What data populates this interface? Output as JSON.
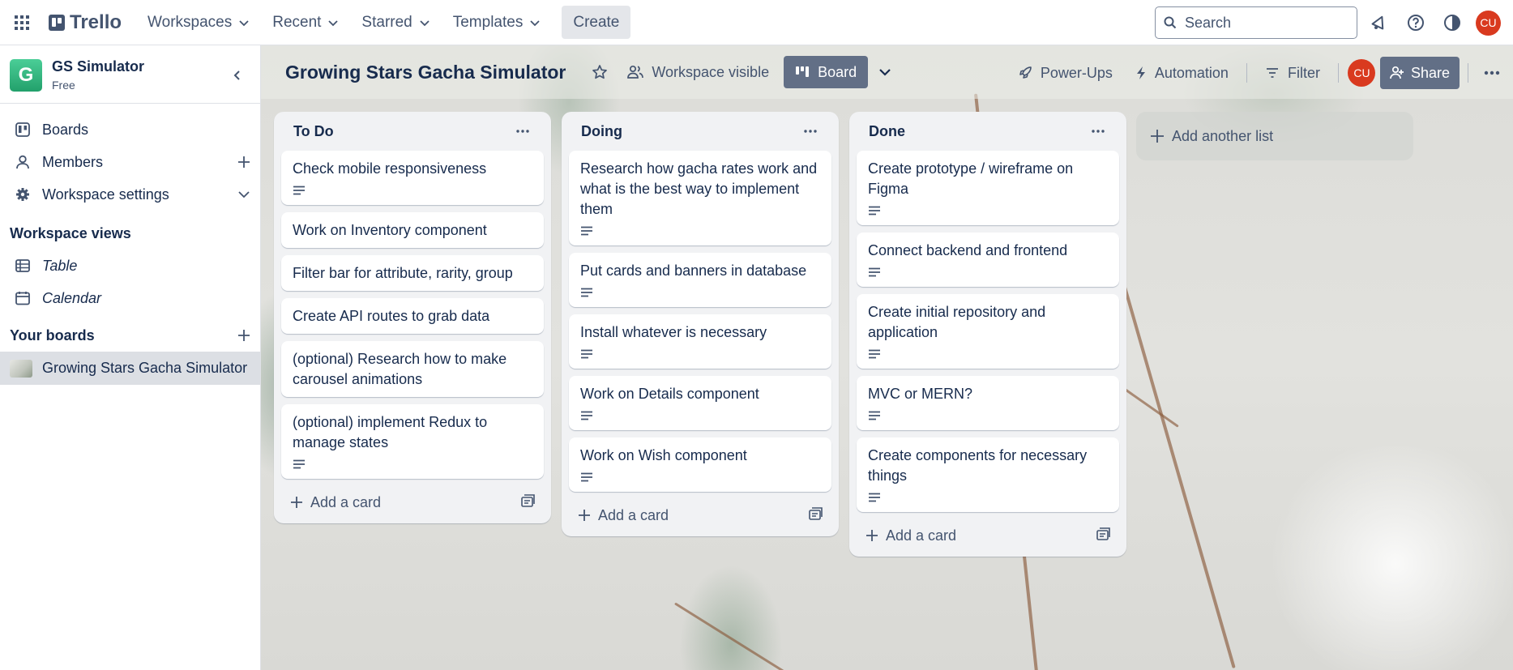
{
  "topnav": {
    "logo": "Trello",
    "items": [
      {
        "label": "Workspaces"
      },
      {
        "label": "Recent"
      },
      {
        "label": "Starred"
      },
      {
        "label": "Templates"
      }
    ],
    "create": "Create",
    "search_placeholder": "Search",
    "avatar": "CU"
  },
  "sidebar": {
    "workspace_initial": "G",
    "workspace_name": "GS Simulator",
    "workspace_plan": "Free",
    "items": [
      {
        "label": "Boards"
      },
      {
        "label": "Members"
      },
      {
        "label": "Workspace settings"
      }
    ],
    "views_title": "Workspace views",
    "views": [
      {
        "label": "Table"
      },
      {
        "label": "Calendar"
      }
    ],
    "your_boards_title": "Your boards",
    "boards": [
      {
        "label": "Growing Stars Gacha Simulator"
      }
    ]
  },
  "board": {
    "title": "Growing Stars Gacha Simulator",
    "visibility": "Workspace visible",
    "view": "Board",
    "powerups": "Power-Ups",
    "automation": "Automation",
    "filter": "Filter",
    "avatar": "CU",
    "share": "Share",
    "add_list": "Add another list"
  },
  "lists": [
    {
      "title": "To Do",
      "add_card": "Add a card",
      "cards": [
        {
          "text": "Check mobile responsiveness",
          "desc": true
        },
        {
          "text": "Work on Inventory component",
          "desc": false
        },
        {
          "text": "Filter bar for attribute, rarity, group",
          "desc": false
        },
        {
          "text": "Create API routes to grab data",
          "desc": false
        },
        {
          "text": "(optional) Research how to make carousel animations",
          "desc": false
        },
        {
          "text": "(optional) implement Redux to manage states",
          "desc": true
        }
      ]
    },
    {
      "title": "Doing",
      "add_card": "Add a card",
      "cards": [
        {
          "text": "Research how gacha rates work and what is the best way to implement them",
          "desc": true
        },
        {
          "text": "Put cards and banners in database",
          "desc": true
        },
        {
          "text": "Install whatever is necessary",
          "desc": true
        },
        {
          "text": "Work on Details component",
          "desc": true
        },
        {
          "text": "Work on Wish component",
          "desc": true
        }
      ]
    },
    {
      "title": "Done",
      "add_card": "Add a card",
      "cards": [
        {
          "text": "Create prototype / wireframe on Figma",
          "desc": true
        },
        {
          "text": "Connect backend and frontend",
          "desc": true
        },
        {
          "text": "Create initial repository and application",
          "desc": true
        },
        {
          "text": "MVC or MERN?",
          "desc": true
        },
        {
          "text": "Create components for necessary things",
          "desc": true
        }
      ]
    }
  ],
  "colors": {
    "avatar": "#d93a1f",
    "workspace_logo": "#22a06b",
    "view_button": "#626f86"
  }
}
